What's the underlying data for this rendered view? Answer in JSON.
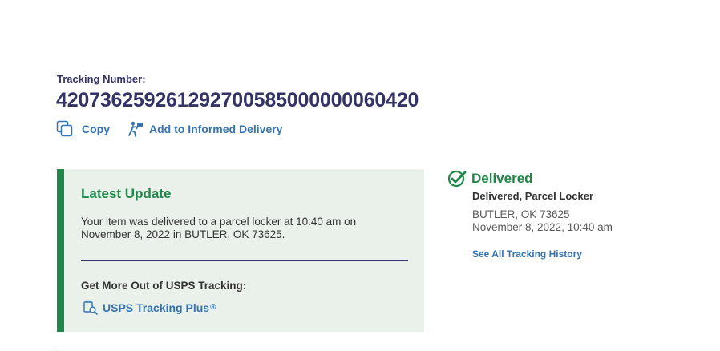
{
  "tracking": {
    "label": "Tracking Number:",
    "number": "420736259261292700585000000060420"
  },
  "actions": {
    "copy_label": "Copy",
    "informed_label": "Add to Informed Delivery"
  },
  "latest_update": {
    "title": "Latest Update",
    "text": "Your item was delivered to a parcel locker at 10:40 am on November 8, 2022 in BUTLER, OK 73625.",
    "more_title": "Get More Out of USPS Tracking:",
    "plus_label": "USPS Tracking Plus",
    "plus_mark": "®"
  },
  "status": {
    "title": "Delivered",
    "subtitle": "Delivered, Parcel Locker",
    "location": "BUTLER, OK 73625",
    "datetime": "November 8, 2022, 10:40 am",
    "history_link": "See All Tracking History"
  },
  "colors": {
    "navy": "#333366",
    "green": "#218748",
    "link_blue": "#3573b1",
    "update_bg": "#eaf1ea"
  },
  "icons": {
    "copy": "copy-icon",
    "informed": "informed-delivery-icon",
    "plus": "tracking-plus-icon",
    "status": "check-circle-icon"
  }
}
